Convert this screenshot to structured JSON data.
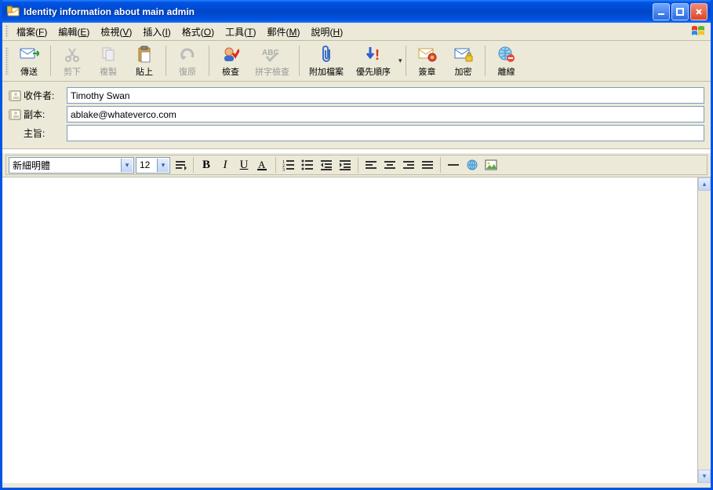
{
  "window": {
    "title": "Identity information about main admin"
  },
  "menu": {
    "file": {
      "label": "檔案",
      "key": "F"
    },
    "edit": {
      "label": "編輯",
      "key": "E"
    },
    "view": {
      "label": "檢視",
      "key": "V"
    },
    "insert": {
      "label": "插入",
      "key": "I"
    },
    "format": {
      "label": "格式",
      "key": "O"
    },
    "tools": {
      "label": "工具",
      "key": "T"
    },
    "mail": {
      "label": "郵件",
      "key": "M"
    },
    "help": {
      "label": "說明",
      "key": "H"
    }
  },
  "toolbar": {
    "send": "傳送",
    "cut": "剪下",
    "copy": "複製",
    "paste": "貼上",
    "undo": "復原",
    "check": "檢查",
    "spell": "拼字檢查",
    "attach": "附加檔案",
    "priority": "優先順序",
    "sign": "簽章",
    "encrypt": "加密",
    "offline": "離線"
  },
  "fields": {
    "to_label": "收件者:",
    "cc_label": "副本:",
    "subject_label": "主旨:",
    "to_value": "Timothy Swan",
    "cc_value": "ablake@whateverco.com",
    "subject_value": ""
  },
  "format": {
    "font_name": "新細明體",
    "font_size": "12"
  },
  "compose": {
    "body": ""
  }
}
